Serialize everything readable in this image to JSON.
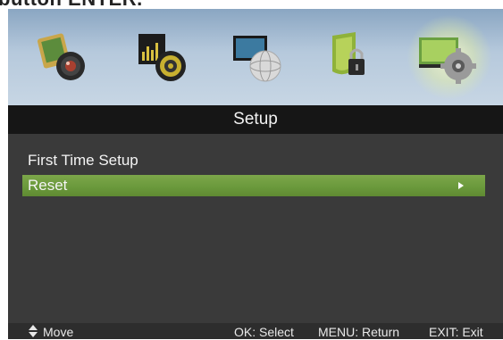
{
  "caption_fragment": "button ENTER.",
  "menu": {
    "title": "Setup",
    "icons": [
      {
        "name": "picture-icon",
        "active": false
      },
      {
        "name": "sound-icon",
        "active": false
      },
      {
        "name": "channel-icon",
        "active": false
      },
      {
        "name": "lock-icon",
        "active": false
      },
      {
        "name": "setup-icon",
        "active": true
      }
    ],
    "items": [
      {
        "label": "First Time Setup",
        "selected": false
      },
      {
        "label": "Reset",
        "selected": true,
        "has_submenu": true
      }
    ],
    "selection_color": "#6f9c3f"
  },
  "footer": {
    "move_label": "Move",
    "select_hint": "OK: Select",
    "return_hint": "MENU: Return",
    "exit_hint": "EXIT: Exit"
  }
}
